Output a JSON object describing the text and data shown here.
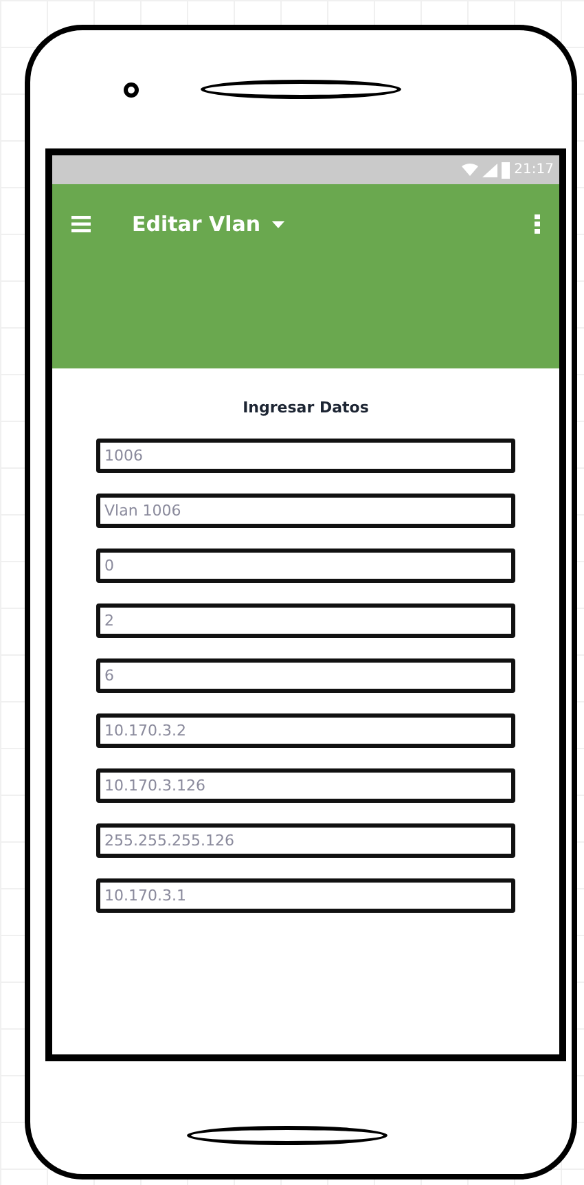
{
  "status_bar": {
    "time": "21:17"
  },
  "app_bar": {
    "title": "Editar Vlan"
  },
  "form": {
    "title": "Ingresar Datos",
    "fields": [
      {
        "value": "1006"
      },
      {
        "value": "Vlan 1006"
      },
      {
        "value": "0"
      },
      {
        "value": "2"
      },
      {
        "value": "6"
      },
      {
        "value": "10.170.3.2"
      },
      {
        "value": "10.170.3.126"
      },
      {
        "value": "255.255.255.126"
      },
      {
        "value": "10.170.3.1"
      }
    ]
  }
}
